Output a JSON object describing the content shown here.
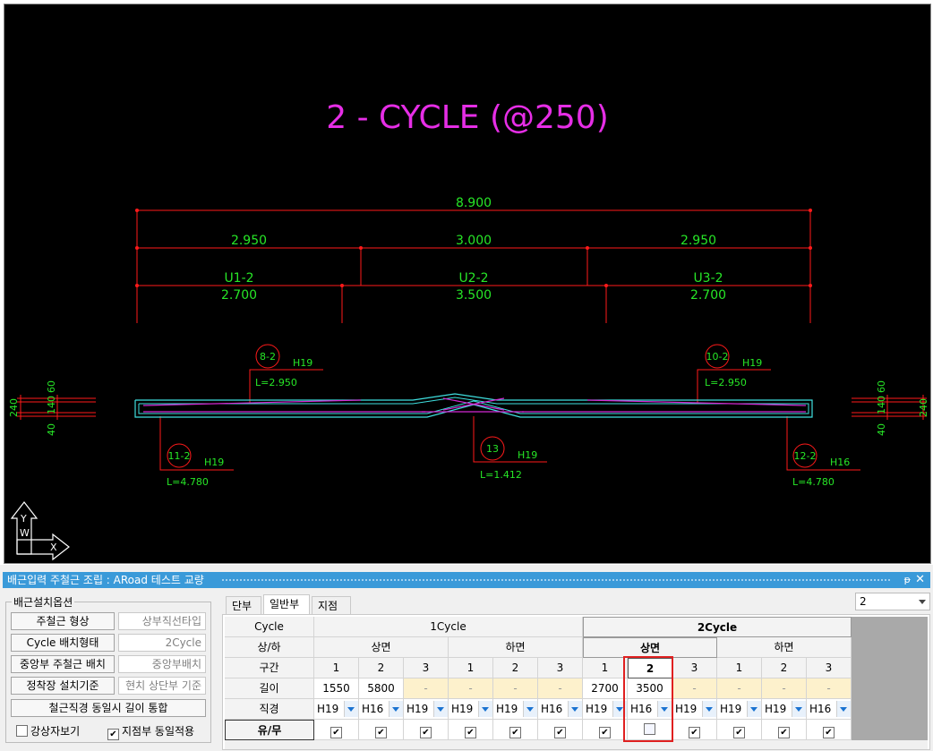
{
  "drawing": {
    "title": "2 - CYCLE (@250)",
    "dims": {
      "total": "8.900",
      "seg1": "2.950",
      "seg2": "3.000",
      "seg3": "2.950",
      "u1": "U1-2",
      "u1len": "2.700",
      "u2": "U2-2",
      "u2len": "3.500",
      "u3": "U3-2",
      "u3len": "2.700"
    },
    "markers": [
      {
        "id": "8-2",
        "bar": "H19",
        "len": "L=2.950"
      },
      {
        "id": "10-2",
        "bar": "H19",
        "len": "L=2.950"
      },
      {
        "id": "11-2",
        "bar": "H19",
        "len": "L=4.780"
      },
      {
        "id": "13",
        "bar": "H19",
        "len": "L=1.412"
      },
      {
        "id": "12-2",
        "bar": "H16",
        "len": "L=4.780"
      }
    ],
    "side": {
      "total": "240",
      "a": "60",
      "b": "140",
      "c": "40"
    },
    "ucs": {
      "y": "Y",
      "w": "W",
      "x": "X"
    }
  },
  "window": {
    "title": "배근입력 주철근 조립 : ARoad 테스트 교량",
    "pin": "ᵽ",
    "close": "✕"
  },
  "options": {
    "group_label": "배근설치옵션",
    "rows": [
      {
        "button": "주철근 형상",
        "value": "상부직선타입"
      },
      {
        "button": "Cycle 배치형태",
        "value": "2Cycle"
      },
      {
        "button": "중앙부 주철근 배치",
        "value": "중앙부배치"
      },
      {
        "button": "정착장 설치기준",
        "value": "현치 상단부 기준"
      }
    ],
    "merge_button": "철근직경 동일시 길이 통합",
    "check1": {
      "label": "강상자보기",
      "checked": false
    },
    "check2": {
      "label": "지점부 동일적용",
      "checked": true
    }
  },
  "tabs": [
    "단부",
    "일반부",
    "지점부"
  ],
  "active_tab": 1,
  "top_select": {
    "value": "2"
  },
  "grid": {
    "row_labels": [
      "Cycle",
      "상/하",
      "구간",
      "길이",
      "직경",
      "유/무"
    ],
    "cycles": [
      "1Cycle",
      "2Cycle"
    ],
    "faces": [
      "상면",
      "하면",
      "상면",
      "하면"
    ],
    "sections": [
      "1",
      "2",
      "3",
      "1",
      "2",
      "3",
      "1",
      "2",
      "3",
      "1",
      "2",
      "3"
    ],
    "lengths": [
      "1550",
      "5800",
      "-",
      "-",
      "-",
      "-",
      "2700",
      "3500",
      "-",
      "-",
      "-",
      "-"
    ],
    "diameters": [
      "H19",
      "H16",
      "H19",
      "H19",
      "H19",
      "H16",
      "H19",
      "H16",
      "H19",
      "H19",
      "H19",
      "H16"
    ],
    "presence": [
      true,
      true,
      true,
      true,
      true,
      true,
      true,
      false,
      true,
      true,
      true,
      true
    ]
  },
  "colors": {
    "title_magenta": "#e62ee6",
    "dim_green": "#27e627",
    "line_red": "#ff1a1a",
    "slab_cyan": "#3fe0e0",
    "rebar_magenta": "#d228d2",
    "highlight_red": "#e02020"
  }
}
